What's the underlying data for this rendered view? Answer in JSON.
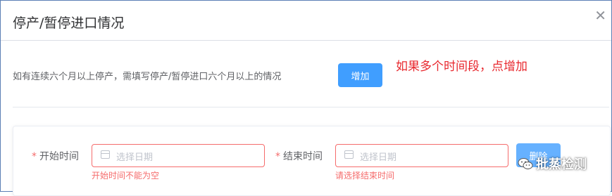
{
  "dialog": {
    "title": "停产/暂停进口情况",
    "close_icon": "close-icon"
  },
  "notice": {
    "text": "如有连续六个月以上停产，需填写停产/暂停进口六个月以上的情况",
    "add_label": "增加"
  },
  "annotation": {
    "text": "如果多个时间段，点增加",
    "color": "#e8282e"
  },
  "period": {
    "start": {
      "required_mark": "*",
      "label": "开始时间",
      "placeholder": "选择日期",
      "value": "",
      "error": "开始时间不能为空",
      "icon": "calendar-icon"
    },
    "end": {
      "required_mark": "*",
      "label": "结束时间",
      "placeholder": "选择日期",
      "value": "",
      "error": "请选择结束时间",
      "icon": "calendar-icon"
    },
    "delete_label": "删除"
  },
  "watermark": {
    "text": "批蒸检测",
    "icon": "wechat-logo-icon"
  },
  "colors": {
    "primary": "#409eff",
    "error": "#f56c6c",
    "frame_border": "#5b7fb5"
  }
}
